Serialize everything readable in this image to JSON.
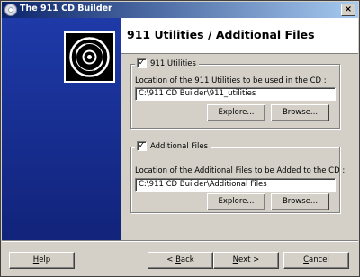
{
  "window": {
    "title": "The 911 CD Builder",
    "close_glyph": "×"
  },
  "header": {
    "title": "911 Utilities / Additional Files"
  },
  "groups": [
    {
      "checkbox_label": "911 Utilities",
      "checked": true,
      "field_label": "Location of the 911 Utilities to be used in the CD :",
      "field_value": "C:\\911 CD Builder\\911_utilities",
      "explore_label": "Explore...",
      "browse_label": "Browse..."
    },
    {
      "checkbox_label": "Additional Files",
      "checked": true,
      "field_label": "Location of the Additional Files to be Added to the CD :",
      "field_value": "C:\\911 CD Builder\\Additional Files",
      "explore_label": "Explore...",
      "browse_label": "Browse..."
    }
  ],
  "footer": {
    "help": {
      "pre": "",
      "key": "H",
      "post": "elp"
    },
    "back": {
      "pre": "< ",
      "key": "B",
      "post": "ack"
    },
    "next": {
      "pre": "",
      "key": "N",
      "post": "ext >"
    },
    "cancel": {
      "pre": "",
      "key": "C",
      "post": "ancel"
    }
  },
  "colors": {
    "sidebar": "#1e3aa8",
    "titlebar": "#0a246a",
    "dialog": "#d4d0c8"
  },
  "icons": {
    "title_icon": "cd-disc-icon",
    "logo": "cd-disc-icon",
    "check": "✓"
  }
}
